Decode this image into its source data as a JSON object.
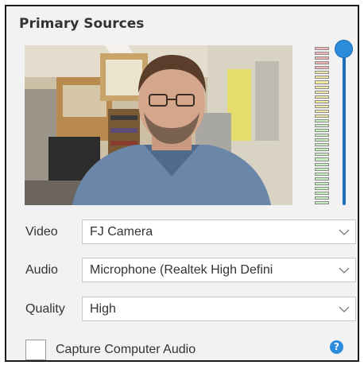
{
  "panel": {
    "title": "Primary Sources"
  },
  "preview": {
    "icon": "webcam-preview"
  },
  "audio_meter": {
    "segments": 33,
    "red_segments": 5,
    "yellow_segments": 10,
    "green_segments": 18,
    "colors": {
      "red": "#f2b4b4",
      "yellow": "#f1e9a3",
      "green": "#c8efc0"
    }
  },
  "volume": {
    "level": 1.0,
    "accent": "#2d8bdc"
  },
  "video": {
    "label": "Video",
    "value": "FJ Camera"
  },
  "audio": {
    "label": "Audio",
    "value": "Microphone (Realtek High Defini"
  },
  "quality": {
    "label": "Quality",
    "value": "High"
  },
  "capture": {
    "label": "Capture Computer Audio",
    "checked": false
  },
  "help": {
    "icon": "help-icon",
    "glyph": "?"
  }
}
